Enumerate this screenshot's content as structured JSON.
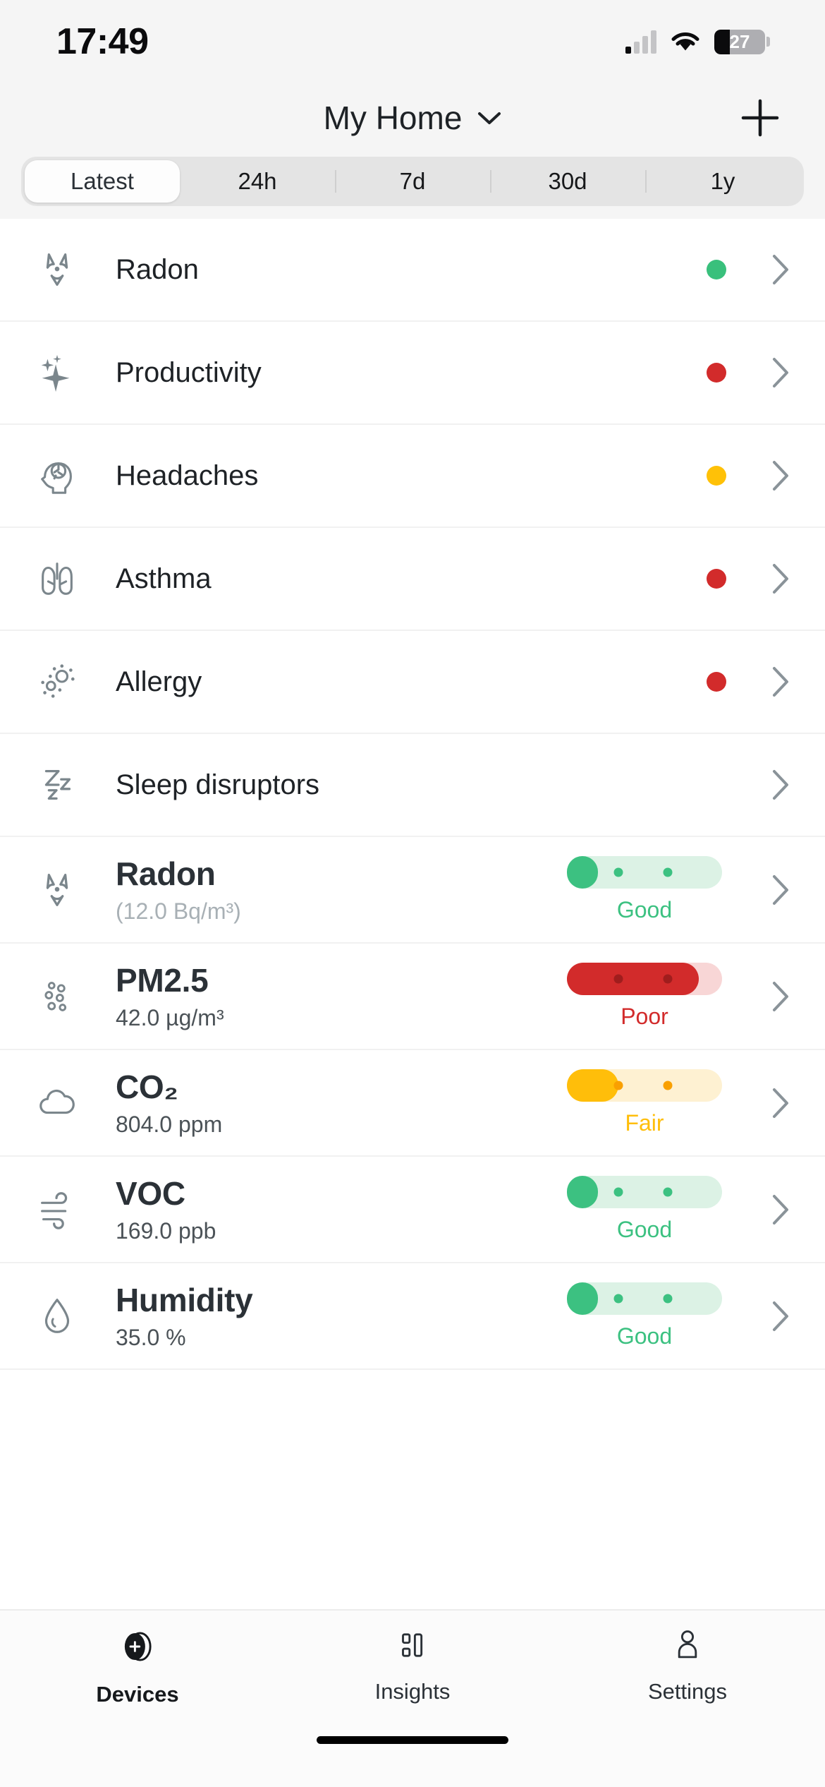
{
  "status_bar": {
    "time": "17:49",
    "battery_percent": "27",
    "battery_level": 30,
    "signal_icon": "cellular-signal-icon",
    "wifi_icon": "wifi-icon",
    "battery_icon": "battery-icon"
  },
  "header": {
    "title": "My Home",
    "dropdown_icon": "chevron-down-icon",
    "add_icon": "plus-icon"
  },
  "segments": {
    "selected": "Latest",
    "items": [
      {
        "label": "Latest",
        "active": true
      },
      {
        "label": "24h",
        "active": false
      },
      {
        "label": "7d",
        "active": false
      },
      {
        "label": "30d",
        "active": false
      },
      {
        "label": "1y",
        "active": false
      }
    ]
  },
  "insight_rows": [
    {
      "label": "Radon",
      "icon": "radiation-icon",
      "status_color": "#39c07c",
      "has_dot": true,
      "chevron_icon": "chevron-right-icon"
    },
    {
      "label": "Productivity",
      "icon": "sparkle-icon",
      "status_color": "#d22b2b",
      "has_dot": true,
      "chevron_icon": "chevron-right-icon"
    },
    {
      "label": "Headaches",
      "icon": "head-brain-icon",
      "status_color": "#ffc107",
      "has_dot": true,
      "chevron_icon": "chevron-right-icon"
    },
    {
      "label": "Asthma",
      "icon": "lungs-icon",
      "status_color": "#d22b2b",
      "has_dot": true,
      "chevron_icon": "chevron-right-icon"
    },
    {
      "label": "Allergy",
      "icon": "pollen-icon",
      "status_color": "#d22b2b",
      "has_dot": true,
      "chevron_icon": "chevron-right-icon"
    },
    {
      "label": "Sleep disruptors",
      "icon": "zzz-sleep-icon",
      "status_color": "",
      "has_dot": false,
      "chevron_icon": "chevron-right-icon"
    }
  ],
  "sensor_cards": [
    {
      "name": "Radon",
      "value": "(12.0 Bq/m³)",
      "value_muted": true,
      "icon": "radiation-icon",
      "status_label": "Good",
      "fill_percent": 20,
      "dots": [
        33,
        65
      ],
      "color": "#3cc181",
      "track_color": "#dcf2e5",
      "dot_color": "#3cc181",
      "chevron_icon": "chevron-right-icon"
    },
    {
      "name": "PM2.5",
      "value": "42.0 µg/m³",
      "value_muted": false,
      "icon": "particles-icon",
      "status_label": "Poor",
      "fill_percent": 85,
      "dots": [
        33,
        65
      ],
      "color": "#d22b2b",
      "track_color": "#f8d6d6",
      "dot_color": "#a01d1d",
      "chevron_icon": "chevron-right-icon"
    },
    {
      "name": "CO₂",
      "value": "804.0 ppm",
      "value_muted": false,
      "icon": "cloud-icon",
      "status_label": "Fair",
      "fill_percent": 33,
      "dots": [
        33,
        65
      ],
      "color": "#ffbe0a",
      "track_color": "#fef1d2",
      "dot_color": "#f9a000",
      "chevron_icon": "chevron-right-icon"
    },
    {
      "name": "VOC",
      "value": "169.0 ppb",
      "value_muted": false,
      "icon": "airflow-icon",
      "status_label": "Good",
      "fill_percent": 20,
      "dots": [
        33,
        65
      ],
      "color": "#3cc181",
      "track_color": "#dcf2e5",
      "dot_color": "#3cc181",
      "chevron_icon": "chevron-right-icon"
    },
    {
      "name": "Humidity",
      "value": "35.0 %",
      "value_muted": false,
      "icon": "droplet-icon",
      "status_label": "Good",
      "fill_percent": 20,
      "dots": [
        33,
        65
      ],
      "color": "#3cc181",
      "track_color": "#dcf2e5",
      "dot_color": "#3cc181",
      "chevron_icon": "chevron-right-icon"
    }
  ],
  "tabbar": {
    "active": "Devices",
    "items": [
      {
        "label": "Devices",
        "icon": "device-puck-icon"
      },
      {
        "label": "Insights",
        "icon": "bar-chart-icon"
      },
      {
        "label": "Settings",
        "icon": "person-icon"
      }
    ]
  },
  "colors": {
    "good": "#3cc181",
    "fair": "#ffbe0a",
    "poor": "#d22b2b",
    "text_primary": "#2b3137",
    "text_muted": "#a8b0b5"
  }
}
